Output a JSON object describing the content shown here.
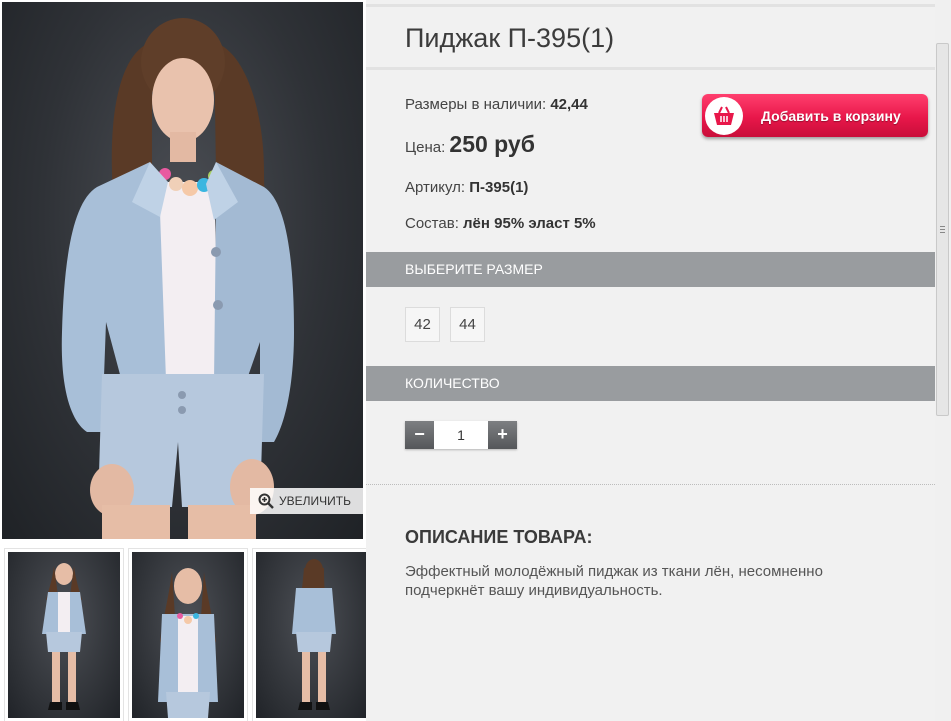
{
  "product": {
    "title": "Пиджак П-395(1)",
    "sizes_label": "Размеры в наличии:",
    "sizes_value": "42,44",
    "price_label": "Цена:",
    "price_value": "250 руб",
    "article_label": "Артикул:",
    "article_value": "П-395(1)",
    "composition_label": "Состав:",
    "composition_value": "лён 95% эласт 5%"
  },
  "cart_button": {
    "label": "Добавить в корзину",
    "icon": "shopping-basket-icon"
  },
  "gallery": {
    "zoom_label": "УВЕЛИЧИТЬ",
    "zoom_icon": "magnifier-plus-icon"
  },
  "size_section": {
    "title": "ВЫБЕРИТЕ РАЗМЕР",
    "options": [
      "42",
      "44"
    ]
  },
  "quantity_section": {
    "title": "КОЛИЧЕСТВО",
    "minus": "−",
    "plus": "+",
    "value": "1"
  },
  "description": {
    "heading": "ОПИСАНИЕ ТОВАРА:",
    "text": "Эффектный молодёжный пиджак из ткани лён, несомненно подчеркнёт вашу индивидуальность."
  },
  "colors": {
    "accent": "#e8174a",
    "section_bar": "#999c9f",
    "background": "#f1f1f1"
  }
}
